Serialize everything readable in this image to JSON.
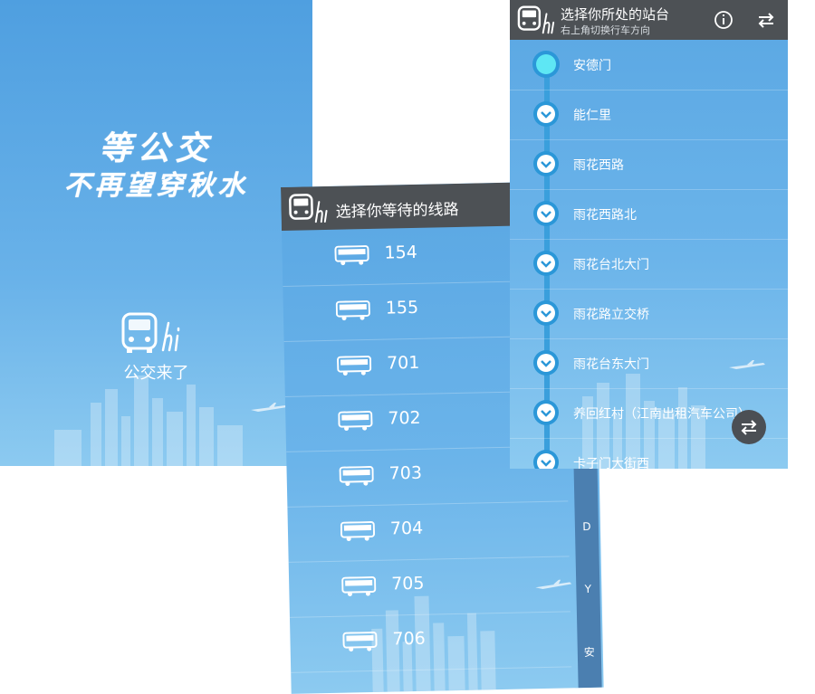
{
  "splash": {
    "slogan_line1": "等公交",
    "slogan_line2": "不再望穿秋水",
    "app_name": "公交来了"
  },
  "routes": {
    "title": "选择你等待的线路",
    "items": [
      {
        "label": "154"
      },
      {
        "label": "155"
      },
      {
        "label": "701"
      },
      {
        "label": "702"
      },
      {
        "label": "703"
      },
      {
        "label": "704"
      },
      {
        "label": "705"
      },
      {
        "label": "706"
      }
    ],
    "index": [
      "D",
      "Y",
      "安"
    ]
  },
  "stations": {
    "title": "选择你所处的站台",
    "subtitle": "右上角切换行车方向",
    "items": [
      {
        "label": "安德门"
      },
      {
        "label": "能仁里"
      },
      {
        "label": "雨花西路"
      },
      {
        "label": "雨花西路北"
      },
      {
        "label": "雨花台北大门"
      },
      {
        "label": "雨花路立交桥"
      },
      {
        "label": "雨花台东大门"
      },
      {
        "label": "养回红村（江南出租汽车公司）"
      },
      {
        "label": "卡子门大街西"
      }
    ]
  },
  "colors": {
    "background_top": "#5aa7e3",
    "header": "#4d5155",
    "track": "#3a9fdc",
    "current_node": "#5ee7f4"
  }
}
